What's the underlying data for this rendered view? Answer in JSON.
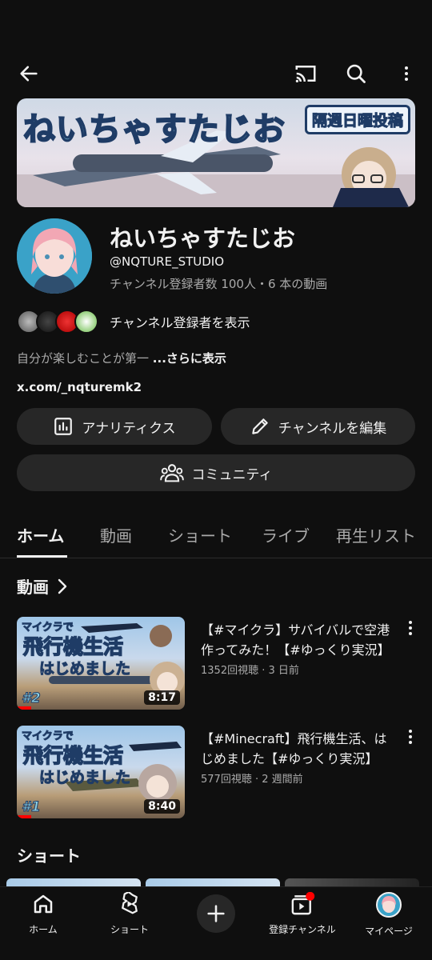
{
  "channel": {
    "banner_title": "ねいちゃすたじお",
    "banner_badge": "隔週日曜投稿",
    "name": "ねいちゃすたじお",
    "handle": "@NQTURE_STUDIO",
    "stats": "チャンネル登録者数 100人・6 本の動画",
    "subscribers_link": "チャンネル登録者を表示",
    "description": "自分が楽しむことが第一",
    "description_more": "...さらに表示",
    "external_link": "x.com/_nqturemk2"
  },
  "actions": {
    "analytics": "アナリティクス",
    "edit_channel": "チャンネルを編集",
    "community": "コミュニティ"
  },
  "tabs": [
    "ホーム",
    "動画",
    "ショート",
    "ライブ",
    "再生リスト"
  ],
  "sections": {
    "videos_title": "動画",
    "shorts_title": "ショート"
  },
  "videos": [
    {
      "thumb_line1": "マイクラで",
      "thumb_line2": "飛行機生活",
      "thumb_line3": "はじめました",
      "episode": "#2",
      "duration": "8:17",
      "title": "【#マイクラ】サバイバルで空港作ってみた！【#ゆっくり実況】",
      "meta": "1352回視聴 · 3 日前"
    },
    {
      "thumb_line1": "マイクラで",
      "thumb_line2": "飛行機生活",
      "thumb_line3": "はじめました",
      "episode": "#1",
      "duration": "8:40",
      "title": "【#Minecraft】飛行機生活、はじめました【#ゆっくり実況】",
      "meta": "577回視聴 · 2 週間前"
    }
  ],
  "nav": {
    "home": "ホーム",
    "shorts": "ショート",
    "subscriptions": "登録チャンネル",
    "mypage": "マイページ"
  },
  "colors": {
    "background": "#0f0f0f",
    "pill": "#272727",
    "text_primary": "#f1f1f1",
    "text_secondary": "#aaaaaa",
    "accent_red": "#ff0000"
  }
}
